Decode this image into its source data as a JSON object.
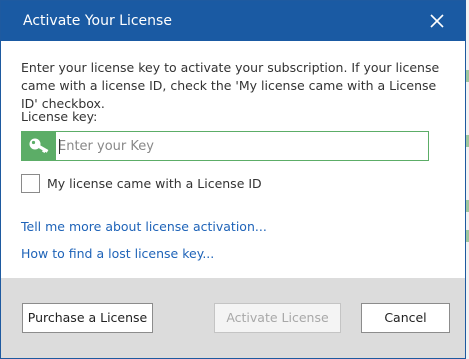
{
  "dialog": {
    "title": "Activate Your License",
    "close_icon": "close-icon",
    "description": "Enter your license key to activate your subscription. If your license came with a license ID, check the 'My license came with a License ID' checkbox.",
    "key_label": "License key:",
    "key_icon": "key-icon",
    "key_input": {
      "value": "",
      "placeholder": "Enter your Key"
    },
    "license_id_checkbox": {
      "label": "My license came with a License ID",
      "checked": false
    },
    "links": {
      "learn_more": "Tell me more about license activation...",
      "lost_key": "How to find a lost license key..."
    },
    "buttons": {
      "purchase": "Purchase a License",
      "activate": "Activate License",
      "cancel": "Cancel"
    }
  },
  "colors": {
    "titlebar": "#1a5aa3",
    "key_accent": "#5cad67",
    "link": "#1e63b8",
    "footer": "#dcdcdc"
  }
}
